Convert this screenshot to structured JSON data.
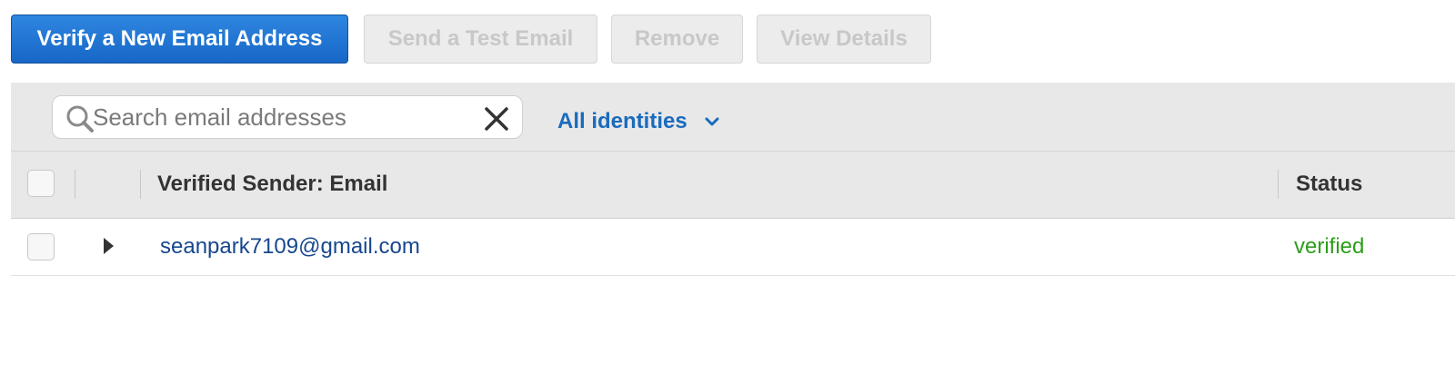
{
  "toolbar": {
    "verify_label": "Verify a New Email Address",
    "test_label": "Send a Test Email",
    "remove_label": "Remove",
    "details_label": "View Details"
  },
  "filter": {
    "search_placeholder": "Search email addresses",
    "search_value": "",
    "identities_label": "All identities",
    "search_icon": "search-icon",
    "clear_icon": "close-icon",
    "dropdown_icon": "chevron-down-icon"
  },
  "table": {
    "columns": [
      "Verified Sender: Email",
      "Status"
    ],
    "rows": [
      {
        "email": "seanpark7109@gmail.com",
        "status": "verified"
      }
    ]
  },
  "colors": {
    "primary": "#1a6bbd",
    "link": "#17478e",
    "verified": "#2c9d1a",
    "header_bg": "#e8e8e8"
  }
}
